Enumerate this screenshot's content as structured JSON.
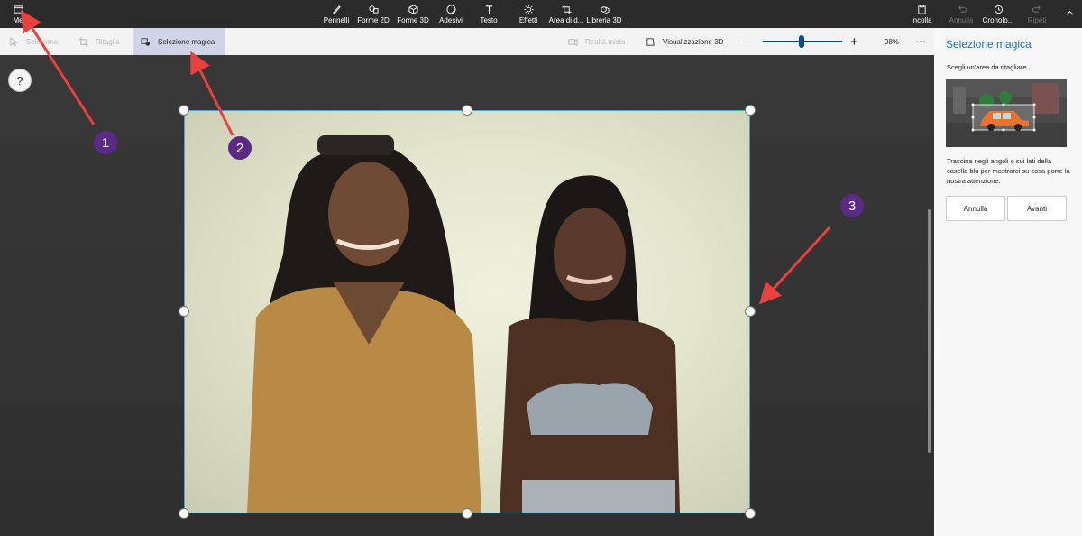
{
  "toolbar": {
    "menu_label": "Me",
    "tools": [
      {
        "label": "Pennelli",
        "icon": "brush-icon"
      },
      {
        "label": "Forme 2D",
        "icon": "shapes-2d-icon"
      },
      {
        "label": "Forme 3D",
        "icon": "cube-icon"
      },
      {
        "label": "Adesivi",
        "icon": "sticker-icon"
      },
      {
        "label": "Testo",
        "icon": "text-icon"
      },
      {
        "label": "Effetti",
        "icon": "sun-icon"
      },
      {
        "label": "Area di d...",
        "icon": "crop-canvas-icon"
      },
      {
        "label": "Libreria 3D",
        "icon": "library-3d-icon"
      }
    ],
    "right": {
      "paste": "Incolla",
      "undo": "Annulla",
      "history": "Cronolo...",
      "redo": "Ripeti"
    }
  },
  "subbar": {
    "select": "Seleziona",
    "crop": "Ritaglia",
    "magic_select": "Selezione magica",
    "mixed_reality": "Realtà mista",
    "view_3d": "Visualizzazione 3D",
    "zoom_percent": 98,
    "zoom_text": "98%",
    "zoom_fraction": 0.49
  },
  "canvas": {
    "help": "?"
  },
  "annotations": [
    "1",
    "2",
    "3"
  ],
  "panel": {
    "title": "Selezione magica",
    "subtitle": "Scegli un'area da ritagliare",
    "description": "Trascina negli angoli o sui lati della casella blu per mostrarci su cosa porre la nostra attenzione.",
    "cancel": "Annulla",
    "next": "Avanti"
  },
  "colors": {
    "accent": "#1f6fb2",
    "badge": "#5b2a86",
    "arrow": "#e8413e",
    "selection": "#4aa3c8"
  }
}
